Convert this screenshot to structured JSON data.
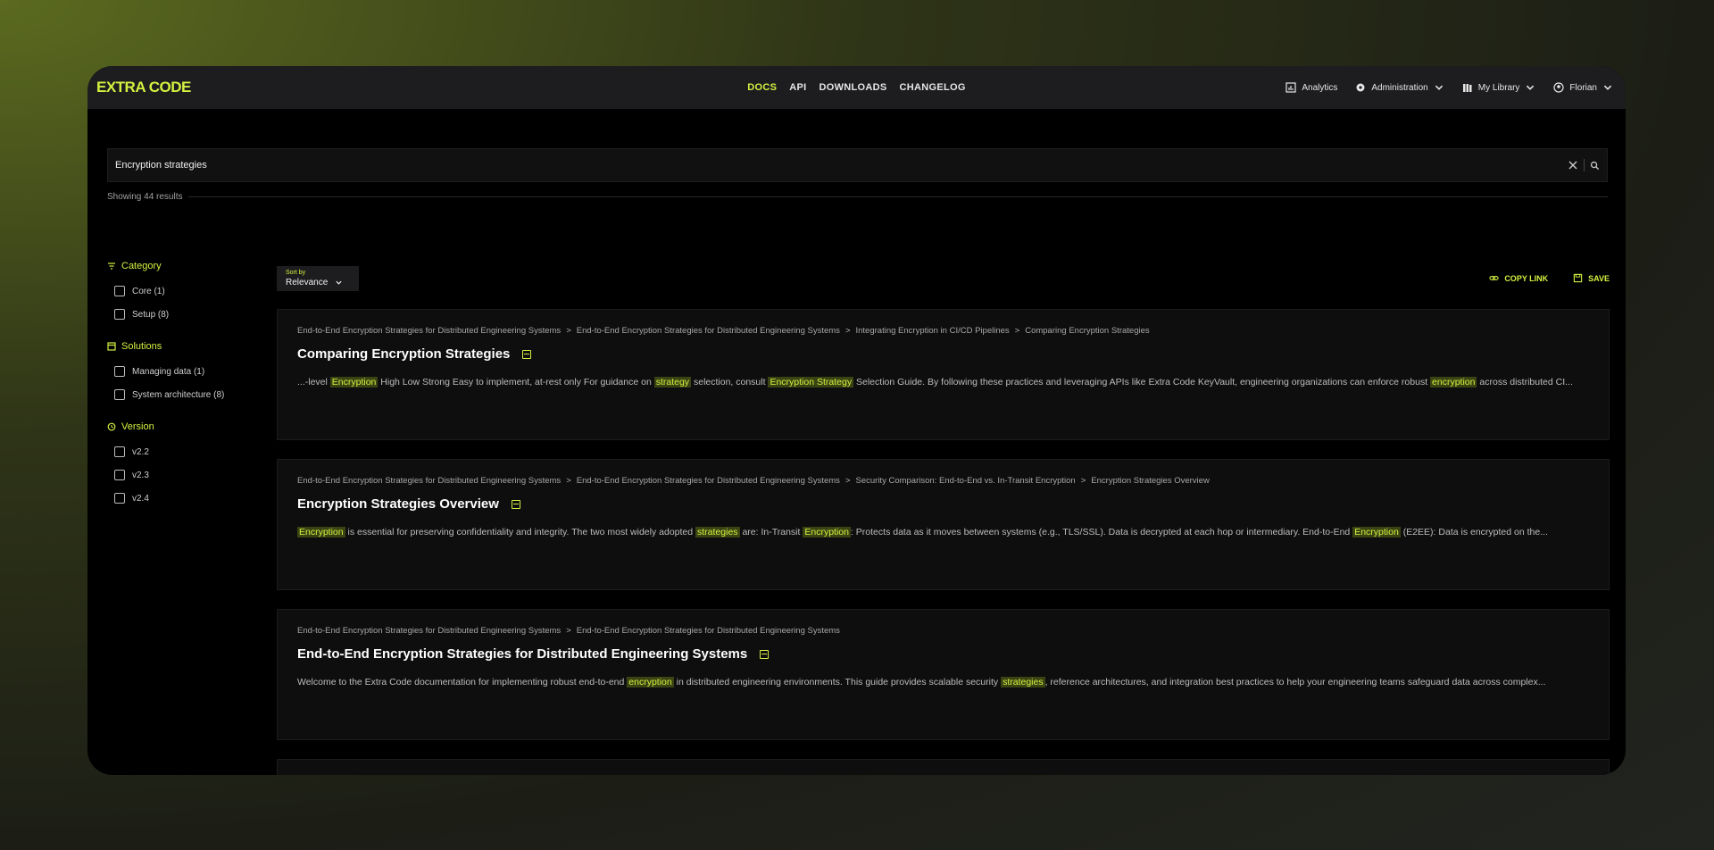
{
  "brand": {
    "logo": "EXTRA CODE",
    "accent": "#d4f040"
  },
  "nav": [
    "DOCS",
    "API",
    "DOWNLOADS",
    "CHANGELOG"
  ],
  "nav_active": "DOCS",
  "user_menu": {
    "analytics": "Analytics",
    "administration": "Administration",
    "library": "My Library",
    "user": "Florian"
  },
  "search": {
    "query": "Encryption strategies",
    "results_text": "Showing 44 results"
  },
  "filters": {
    "category": {
      "title": "Category",
      "options": [
        "Core (1)",
        "Setup (8)"
      ]
    },
    "solutions": {
      "title": "Solutions",
      "options": [
        "Managing data (1)",
        "System architecture (8)"
      ]
    },
    "version": {
      "title": "Version",
      "options": [
        "v2.2",
        "v2.3",
        "v2.4"
      ]
    }
  },
  "sort": {
    "label": "Sort by",
    "value": "Relevance"
  },
  "actions": {
    "copy_link": "COPY LINK",
    "save": "SAVE"
  },
  "results": [
    {
      "crumbs": [
        "End-to-End Encryption Strategies for Distributed Engineering Systems",
        "End-to-End Encryption Strategies for Distributed Engineering Systems",
        "Integrating Encryption in CI/CD Pipelines",
        "Comparing Encryption Strategies"
      ],
      "title": "Comparing Encryption Strategies",
      "snippet": [
        {
          "t": "...-level "
        },
        {
          "h": "Encryption"
        },
        {
          "t": " High Low Strong Easy to implement, at-rest only For guidance on "
        },
        {
          "h": "strategy"
        },
        {
          "t": " selection, consult "
        },
        {
          "h": "Encryption Strategy"
        },
        {
          "t": " Selection Guide. By following these practices and leveraging APIs like Extra Code KeyVault, engineering organizations can enforce robust "
        },
        {
          "h": "encryption"
        },
        {
          "t": " across distributed CI..."
        }
      ]
    },
    {
      "crumbs": [
        "End-to-End Encryption Strategies for Distributed Engineering Systems",
        "End-to-End Encryption Strategies for Distributed Engineering Systems",
        "Security Comparison: End-to-End vs. In-Transit Encryption",
        "Encryption Strategies Overview"
      ],
      "title": "Encryption Strategies Overview",
      "snippet": [
        {
          "h": "Encryption"
        },
        {
          "t": " is essential for preserving confidentiality and integrity. The two most widely adopted "
        },
        {
          "h": "strategies"
        },
        {
          "t": " are: In-Transit "
        },
        {
          "h": "Encryption"
        },
        {
          "t": ": Protects data as it moves between systems (e.g., TLS/SSL). Data is decrypted at each hop or intermediary. End-to-End "
        },
        {
          "h": "Encryption"
        },
        {
          "t": " (E2EE): Data is encrypted on the..."
        }
      ]
    },
    {
      "crumbs": [
        "End-to-End Encryption Strategies for Distributed Engineering Systems",
        "End-to-End Encryption Strategies for Distributed Engineering Systems"
      ],
      "title": "End-to-End Encryption Strategies for Distributed Engineering Systems",
      "snippet": [
        {
          "t": "Welcome to the Extra Code documentation for implementing robust end-to-end "
        },
        {
          "h": "encryption"
        },
        {
          "t": " in distributed engineering environments. This guide provides scalable security "
        },
        {
          "h": "strategies"
        },
        {
          "t": ", reference architectures, and integration best practices to help your engineering teams safeguard data across complex..."
        }
      ]
    }
  ]
}
